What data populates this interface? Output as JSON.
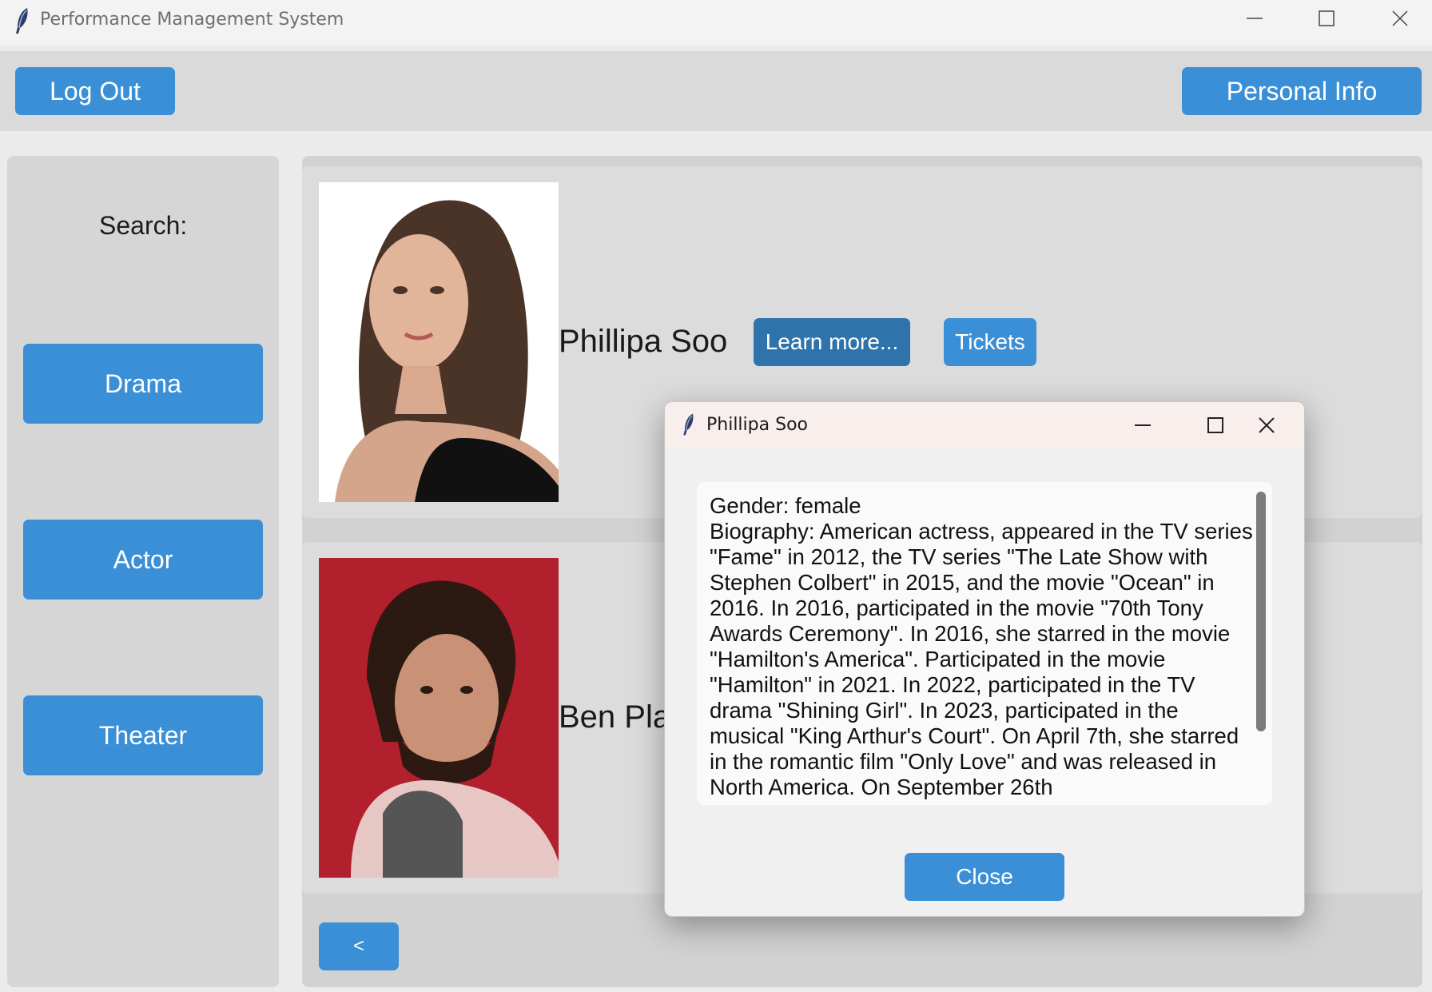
{
  "window": {
    "title": "Performance Management System",
    "controls": {
      "minimize": "—",
      "maximize": "☐",
      "close": "✕"
    }
  },
  "header": {
    "logout_label": "Log Out",
    "personal_info_label": "Personal Info"
  },
  "sidebar": {
    "search_label": "Search:",
    "items": [
      {
        "label": "Drama"
      },
      {
        "label": "Actor"
      },
      {
        "label": "Theater"
      }
    ]
  },
  "main": {
    "actors": [
      {
        "name": "Phillipa Soo",
        "learn_more_label": "Learn more...",
        "tickets_label": "Tickets"
      },
      {
        "name": "Ben Pla"
      }
    ],
    "prev_page_label": "<"
  },
  "dialog": {
    "title": "Phillipa Soo",
    "gender_line": "Gender: female",
    "biography": "Biography: American actress, appeared in the TV series \"Fame\" in 2012, the TV series \"The Late Show with Stephen Colbert\" in 2015, and the movie \"Ocean\" in 2016. In 2016, participated in the movie \"70th Tony Awards Ceremony\". In 2016, she starred in the movie \"Hamilton's America\". Participated in the movie \"Hamilton\" in 2021. In 2022, participated in the TV drama \"Shining Girl\". In 2023, participated in the musical \"King Arthur's Court\". On April 7th, she starred in the romantic film \"Only Love\" and was released in North America. On September 26th",
    "close_label": "Close"
  },
  "colors": {
    "accent": "#3a8fd6",
    "accent_active": "#2f73ad",
    "sidebar_bg": "#d6d6d6",
    "card_bg": "#dcdcdc"
  },
  "icons": [
    "feather-icon",
    "minimize-icon",
    "maximize-icon",
    "close-icon"
  ]
}
